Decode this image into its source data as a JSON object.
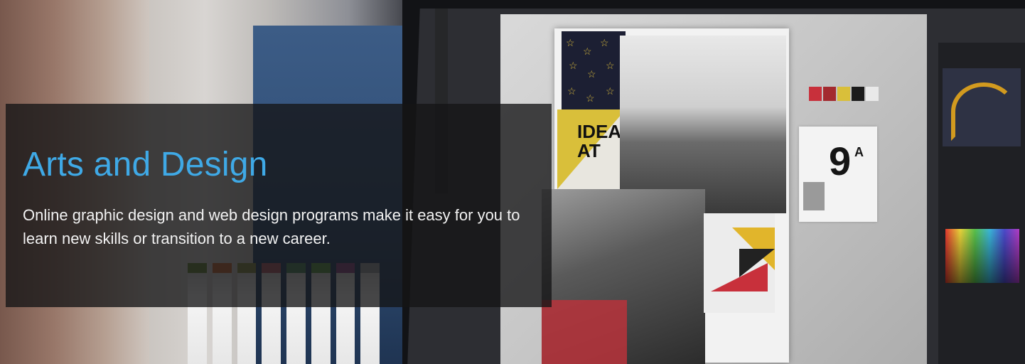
{
  "hero": {
    "title": "Arts and Design",
    "description": "Online graphic design and web design programs make it easy for you to learn new skills or transition to a new career.",
    "title_color": "#3fa9e6",
    "text_color": "#f2f2f2",
    "panel_color": "rgba(20,20,22,0.78)"
  },
  "artwork": {
    "ideas_text": "IDEAS AT",
    "card_number": "9",
    "card_letter": "A",
    "swatch_colors": [
      "#c8303b",
      "#a32a2f",
      "#d9bf3a",
      "#1b1b1b",
      "#e9e9e9"
    ]
  }
}
